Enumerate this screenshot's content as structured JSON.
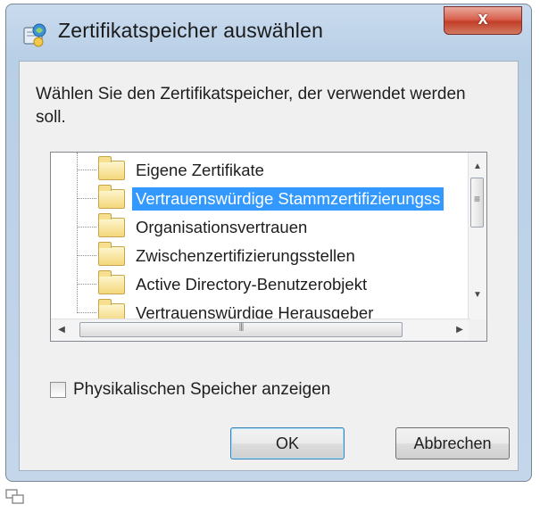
{
  "dialog": {
    "title": "Zertifikatspeicher auswählen",
    "close_label": "x",
    "instruction": "Wählen Sie den Zertifikatspeicher, der verwendet werden soll."
  },
  "tree": {
    "items": [
      {
        "label": "Eigene Zertifikate",
        "selected": false
      },
      {
        "label": "Vertrauenswürdige Stammzertifizierungss",
        "selected": true
      },
      {
        "label": "Organisationsvertrauen",
        "selected": false
      },
      {
        "label": "Zwischenzertifizierungsstellen",
        "selected": false
      },
      {
        "label": "Active Directory-Benutzerobjekt",
        "selected": false
      },
      {
        "label": "Vertrauenswürdige Herausgeber",
        "selected": false
      }
    ],
    "hscroll_grip": "III"
  },
  "checkbox": {
    "label": "Physikalischen Speicher anzeigen",
    "checked": false
  },
  "buttons": {
    "ok": "OK",
    "cancel": "Abbrechen"
  },
  "colors": {
    "selection": "#3399ff",
    "close_button": "#c23e28",
    "frame": "#b9cfe6"
  }
}
